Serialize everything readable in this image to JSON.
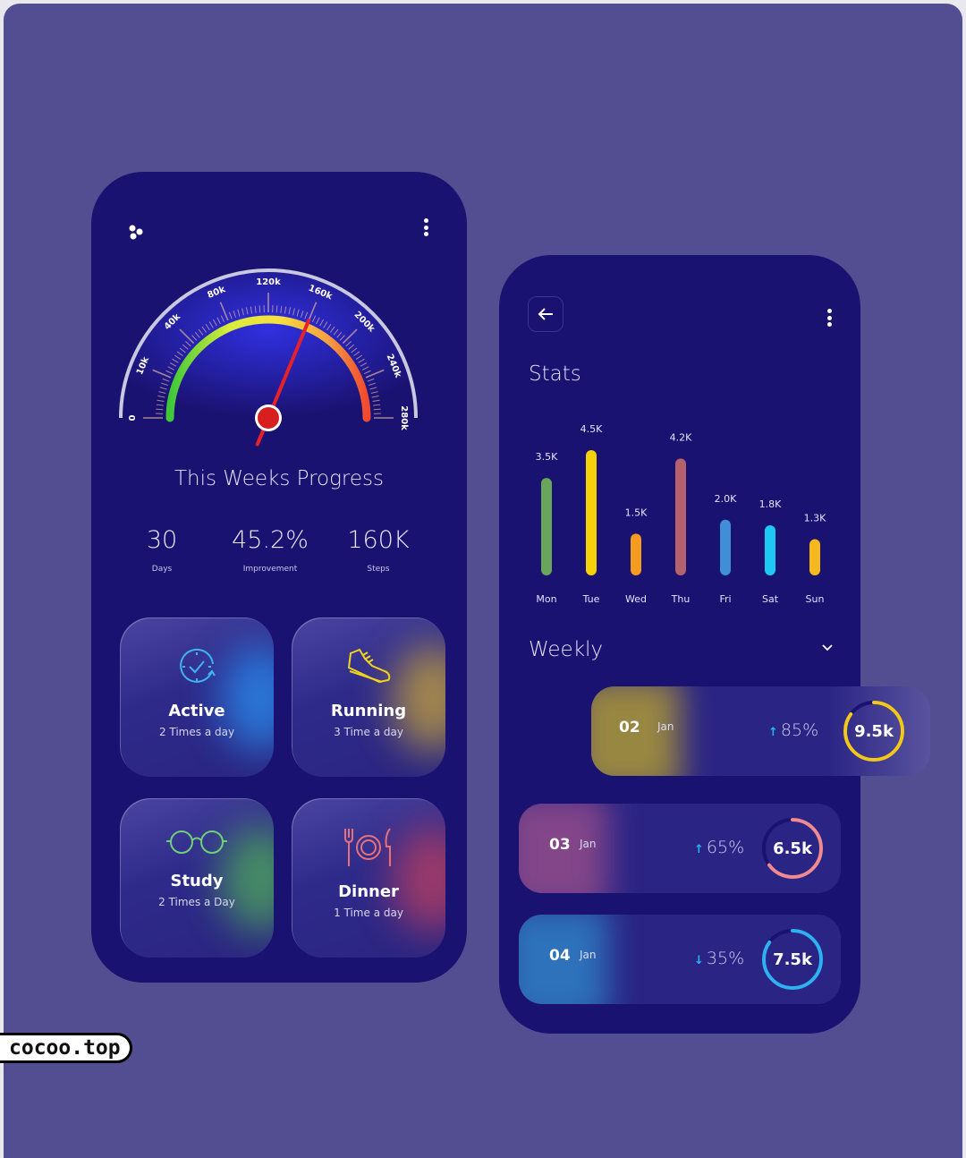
{
  "progress": {
    "title": "This Weeks Progress",
    "gauge": {
      "labels": [
        "0",
        "10k",
        "40k",
        "80k",
        "120k",
        "160k",
        "200k",
        "240k",
        "280k"
      ],
      "needle_label": "160k"
    },
    "stats": [
      {
        "value": "30",
        "label": "Days"
      },
      {
        "value": "45.2%",
        "label": "Improvement"
      },
      {
        "value": "160K",
        "label": "Steps"
      }
    ]
  },
  "activities": [
    {
      "name": "Active",
      "freq": "2 Times a day",
      "icon": "clock-check-icon",
      "color": "#3fb4f0"
    },
    {
      "name": "Running",
      "freq": "3 Time a day",
      "icon": "sneaker-icon",
      "color": "#f2d31b"
    },
    {
      "name": "Study",
      "freq": "2 Times a Day",
      "icon": "glasses-icon",
      "color": "#6fcf7a"
    },
    {
      "name": "Dinner",
      "freq": "1 Time a day",
      "icon": "plate-cutlery-icon",
      "color": "#e8707a"
    }
  ],
  "stats_screen": {
    "title": "Stats",
    "weekly_label": "Weekly"
  },
  "chart_data": {
    "type": "bar",
    "categories": [
      "Mon",
      "Tue",
      "Wed",
      "Thu",
      "Fri",
      "Sat",
      "Sun"
    ],
    "values": [
      3.5,
      4.5,
      1.5,
      4.2,
      2.0,
      1.8,
      1.3
    ],
    "labels": [
      "3.5K",
      "4.5K",
      "1.5K",
      "4.2K",
      "2.0K",
      "1.8K",
      "1.3K"
    ],
    "colors": [
      "#6aa55c",
      "#f5d10a",
      "#f39c1f",
      "#b5616e",
      "#3f8ed6",
      "#1ec8f5",
      "#f5b91e"
    ],
    "unit": "K",
    "grid": false
  },
  "weekly": [
    {
      "day": "02",
      "month": "Jan",
      "dir": "up",
      "pct": "85%",
      "total": "9.5k",
      "fraction": 0.85,
      "color": "#f2c81b",
      "glow": "#b5a030"
    },
    {
      "day": "03",
      "month": "Jan",
      "dir": "up",
      "pct": "65%",
      "total": "6.5k",
      "fraction": 0.65,
      "color": "#ef8a8f",
      "glow": "#9a4f8a"
    },
    {
      "day": "04",
      "month": "Jan",
      "dir": "down",
      "pct": "35%",
      "total": "7.5k",
      "fraction": 0.85,
      "color": "#2fb0f0",
      "glow": "#2f86c9"
    }
  ],
  "watermark": "cocoo.top"
}
